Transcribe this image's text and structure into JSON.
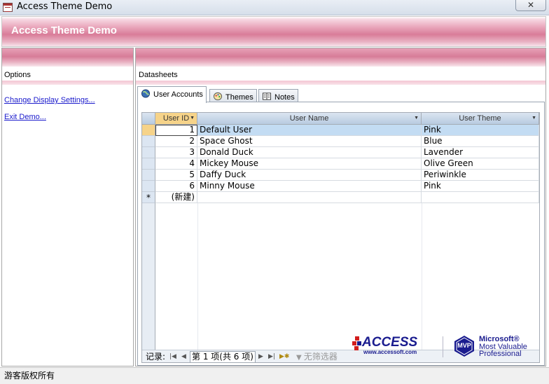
{
  "window": {
    "title": "Access Theme Demo",
    "close_label": "✕"
  },
  "form": {
    "title": "Access Theme Demo"
  },
  "options": {
    "label": "Options",
    "links": [
      {
        "label": "Change Display Settings..."
      },
      {
        "label": "Exit Demo..."
      }
    ]
  },
  "datasheets": {
    "label": "Datasheets",
    "tabs": [
      {
        "label": "User Accounts",
        "icon": "globe-icon",
        "active": true
      },
      {
        "label": "Themes",
        "icon": "palette-icon",
        "active": false
      },
      {
        "label": "Notes",
        "icon": "notes-icon",
        "active": false
      }
    ]
  },
  "grid": {
    "columns": [
      "User ID",
      "User Name",
      "User Theme"
    ],
    "rows": [
      {
        "id": "1",
        "name": "Default User",
        "theme": "Pink"
      },
      {
        "id": "2",
        "name": "Space Ghost",
        "theme": "Blue"
      },
      {
        "id": "3",
        "name": "Donald Duck",
        "theme": "Lavender"
      },
      {
        "id": "4",
        "name": "Mickey Mouse",
        "theme": "Olive Green"
      },
      {
        "id": "5",
        "name": "Daffy Duck",
        "theme": "Periwinkle"
      },
      {
        "id": "6",
        "name": "Minny Mouse",
        "theme": "Pink"
      }
    ],
    "new_row_marker": "*",
    "new_row_label": "(新建)"
  },
  "navigator": {
    "record_label": "记录:",
    "position_text": "第 1 项(共 6 项)",
    "filter_label": "无筛选器"
  },
  "logos": {
    "access_word": "ACCESS",
    "access_url": "www.accessoft.com",
    "mvp_badge": "MVP",
    "mvp_line1": "Microsoft®",
    "mvp_line2": "Most Valuable",
    "mvp_line3": "Professional"
  },
  "status": {
    "text": "游客版权所有"
  },
  "colors": {
    "theme_pink": "#d97c99",
    "selection_blue": "#c3dcf3",
    "link": "#1a1acc"
  }
}
